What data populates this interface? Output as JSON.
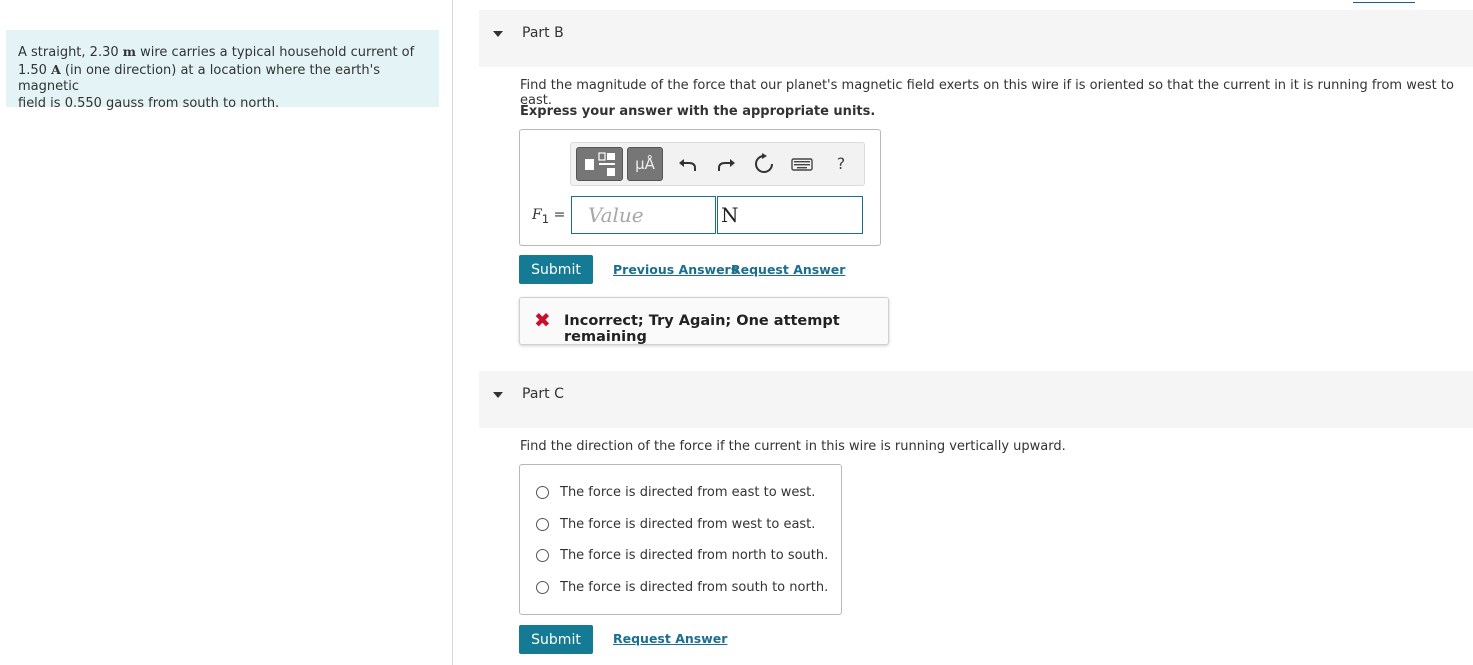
{
  "problem": {
    "text_1": "A straight, 2.30 ",
    "unit_m": "m",
    "text_2": " wire carries a typical household current of",
    "text_3": "1.50 ",
    "unit_A": "A",
    "text_4": " (in one direction) at a location where the earth's magnetic",
    "text_5": "field is 0.550 gauss from south to north."
  },
  "partB": {
    "title": "Part B",
    "prompt": "Find the magnitude of the force that our planet's magnetic field exerts on this wire if is oriented so that the current in it is running from west to east.",
    "instruction": "Express your answer with the appropriate units.",
    "toolbar": {
      "units_label": "μÅ",
      "help_label": "?"
    },
    "variable_base": "F",
    "variable_sub": "1",
    "equals": "=",
    "value_placeholder": "Value",
    "unit_value": "N",
    "submit_label": "Submit",
    "previous_answers_label": "Previous Answers",
    "request_answer_label": "Request Answer",
    "feedback_icon": "✖",
    "feedback_text": "Incorrect; Try Again; One attempt remaining"
  },
  "partC": {
    "title": "Part C",
    "prompt": "Find the direction of the force if the current in this wire is running vertically upward.",
    "options": [
      "The force is directed from east to west.",
      "The force is directed from west to east.",
      "The force is directed from north to south.",
      "The force is directed from south to north."
    ],
    "submit_label": "Submit",
    "request_answer_label": "Request Answer"
  },
  "colors": {
    "accent": "#157a93",
    "link": "#1a6f8f",
    "problem_bg": "#e4f4f6",
    "error": "#c8102e"
  }
}
